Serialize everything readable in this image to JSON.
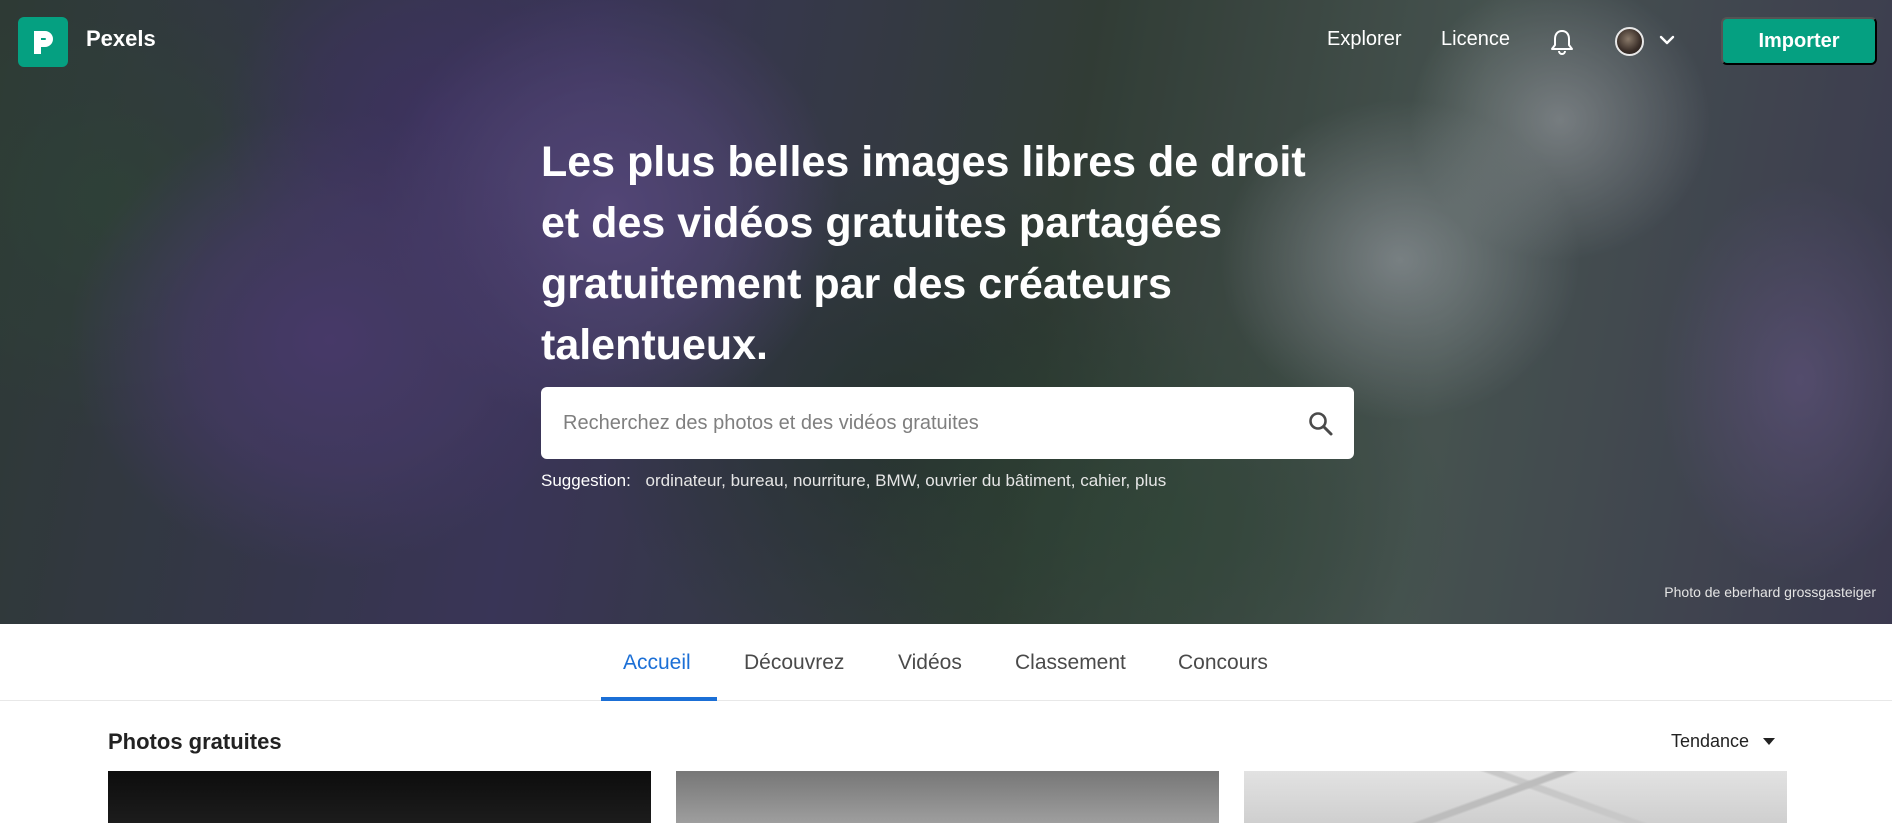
{
  "header": {
    "brand": "Pexels",
    "nav": {
      "explore": "Explorer",
      "license": "Licence"
    },
    "import_label": "Importer"
  },
  "hero": {
    "title": "Les plus belles images libres de droit et des vidéos gratuites partagées gratuitement par des créateurs talentueux.",
    "search": {
      "placeholder": "Recherchez des photos et des vidéos gratuites",
      "value": ""
    },
    "suggestion_label": "Suggestion:",
    "suggestions": "ordinateur, bureau, nourriture, BMW, ouvrier du bâtiment, cahier, plus",
    "credit": "Photo de eberhard grossgasteiger"
  },
  "tabs": [
    {
      "label": "Accueil",
      "active": true
    },
    {
      "label": "Découvrez",
      "active": false
    },
    {
      "label": "Vidéos",
      "active": false
    },
    {
      "label": "Classement",
      "active": false
    },
    {
      "label": "Concours",
      "active": false
    }
  ],
  "section": {
    "title": "Photos gratuites",
    "sort_value": "Tendance"
  },
  "colors": {
    "brand": "#05a081",
    "active_tab": "#1b6fd6"
  },
  "icons": [
    "pexels-logo-icon",
    "bell-icon",
    "chevron-down-icon",
    "search-icon",
    "caret-down-icon"
  ]
}
